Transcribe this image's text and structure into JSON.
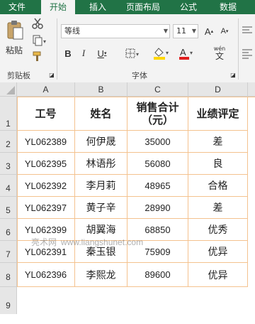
{
  "ribbon": {
    "tabs": [
      "文件",
      "开始",
      "插入",
      "页面布局",
      "公式",
      "数据"
    ],
    "active_tab": "开始",
    "clipboard": {
      "paste_label": "粘贴",
      "group_label": "剪贴板"
    },
    "font": {
      "name": "等线",
      "size": "11",
      "group_label": "字体",
      "wen_label": "wén",
      "wen_char": "文"
    }
  },
  "sheet": {
    "columns": [
      "A",
      "B",
      "C",
      "D"
    ],
    "rows": [
      "1",
      "2",
      "3",
      "4",
      "5",
      "6",
      "7",
      "8",
      "9"
    ],
    "headers": [
      "工号",
      "姓名",
      "销售合计\n（元）",
      "业绩评定"
    ],
    "data": [
      [
        "YL062389",
        "何伊晟",
        "35000",
        "差"
      ],
      [
        "YL062395",
        "林语彤",
        "56080",
        "良"
      ],
      [
        "YL062392",
        "李月莉",
        "48965",
        "合格"
      ],
      [
        "YL062397",
        "黄子辛",
        "28990",
        "差"
      ],
      [
        "YL062399",
        "胡翼海",
        "68850",
        "优秀"
      ],
      [
        "YL062391",
        "秦玉银",
        "75909",
        "优异"
      ],
      [
        "YL062396",
        "李熙龙",
        "89600",
        "优异"
      ]
    ]
  },
  "watermark": {
    "text": "亮术网",
    "url": "www.liangshunet.com"
  },
  "colors": {
    "ribbon_green": "#217346",
    "grid_orange": "#f4c28f",
    "header_gray": "#e6e6e6"
  }
}
